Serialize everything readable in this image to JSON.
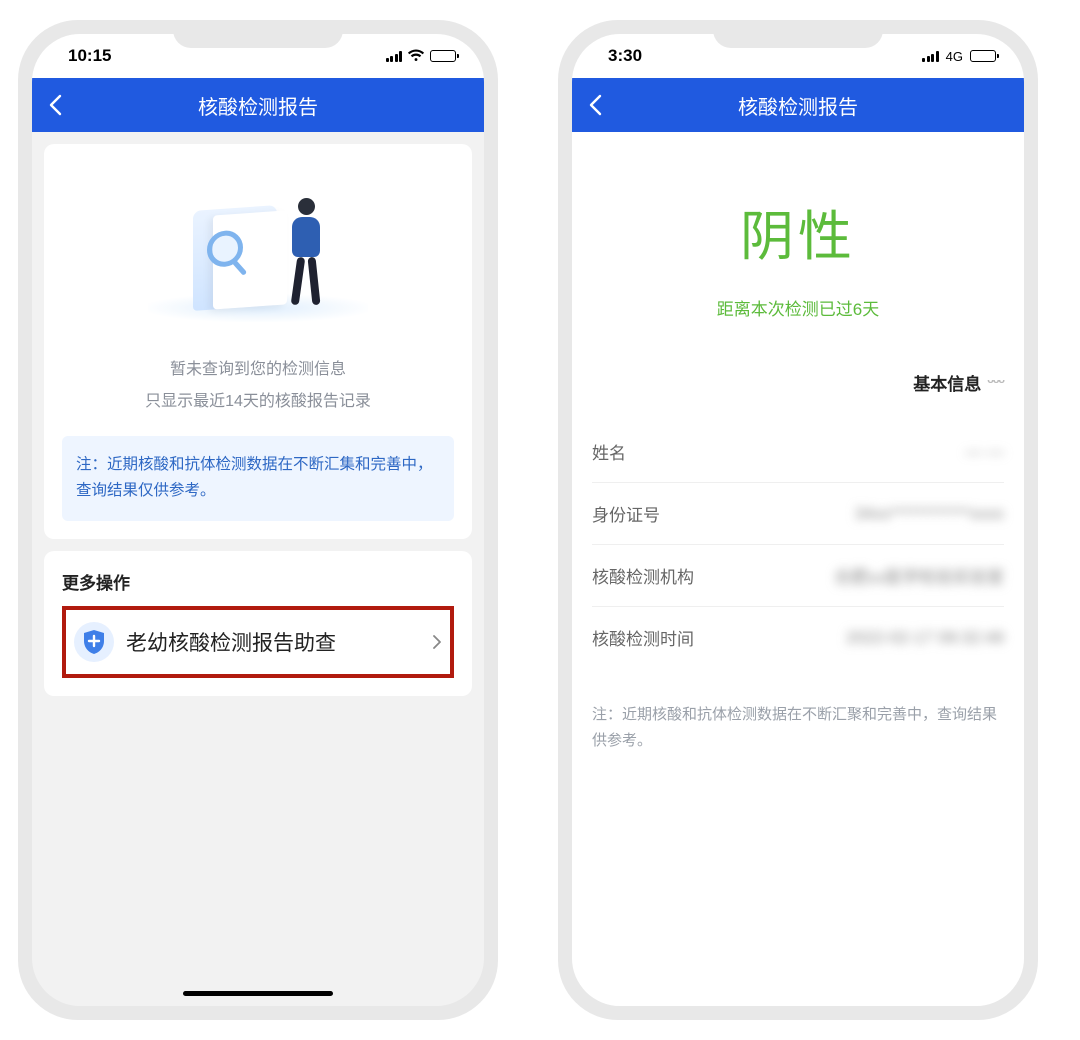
{
  "left": {
    "status_time": "10:15",
    "nav_title": "核酸检测报告",
    "empty_line1": "暂未查询到您的检测信息",
    "empty_line2": "只显示最近14天的核酸报告记录",
    "note": "注：近期核酸和抗体检测数据在不断汇集和完善中，查询结果仅供参考。",
    "more_ops_title": "更多操作",
    "action_label": "老幼核酸检测报告助查"
  },
  "right": {
    "status_time": "3:30",
    "net_label": "4G",
    "nav_title": "核酸检测报告",
    "result": "阴性",
    "result_sub": "距离本次检测已过6天",
    "basic_info_title": "基本信息",
    "rows": [
      {
        "label": "姓名",
        "value": "— —"
      },
      {
        "label": "身份证号",
        "value": "34xx************xxxx"
      },
      {
        "label": "核酸检测机构",
        "value": "合肥xx医学检验实验室"
      },
      {
        "label": "核酸检测时间",
        "value": "2022-02-17 09:32:49"
      }
    ],
    "bottom_note": "注：近期核酸和抗体检测数据在不断汇聚和完善中，查询结果供参考。"
  }
}
